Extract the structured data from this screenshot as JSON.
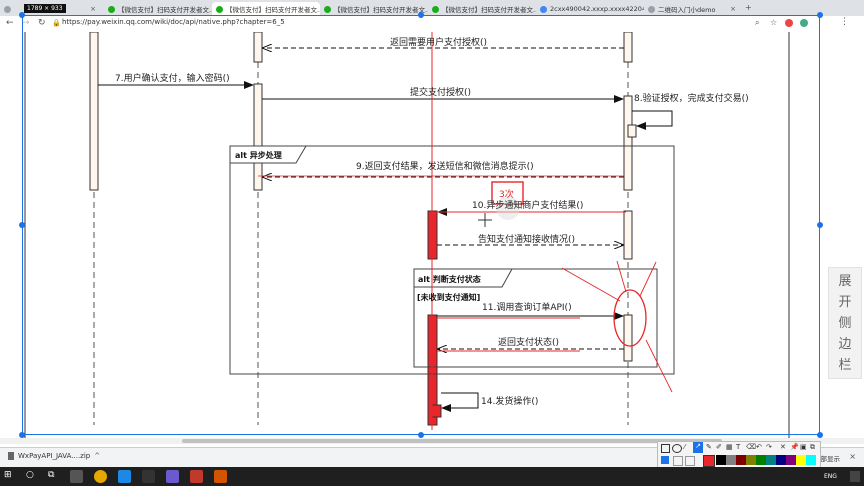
{
  "browser": {
    "tabs": [
      {
        "label": "【微信支付】扫码支付开发者文..."
      },
      {
        "label": "【微信支付】扫码支付开发者文..."
      },
      {
        "label": "【微信支付】扫码支付开发者文..."
      },
      {
        "label": "【微信支付】扫码支付开发者文..."
      },
      {
        "label": "【微信支付】扫码支付开发者文..."
      },
      {
        "label": "2cxx490042.xxxp.xxxx42204/..."
      },
      {
        "label": "二维码入门小demo"
      }
    ],
    "url": "https://pay.weixin.qq.com/wiki/doc/api/native.php?chapter=6_5"
  },
  "snip": {
    "dimensions": "1789 × 933",
    "annotation": "3次"
  },
  "diagram": {
    "msg_return_auth": "返回需要用户支付授权()",
    "msg7": "7.用户确认支付，输入密码()",
    "msg_submit_auth": "提交支付授权()",
    "msg8": "8.验证授权，完成支付交易()",
    "alt1": "alt 异步处理",
    "msg9": "9.返回支付结果，发送短信和微信消息提示()",
    "msg10": "10.异步通知商户支付结果()",
    "msg_notify_status": "告知支付通知接收情况()",
    "alt2": "alt 判断支付状态",
    "guard": "[未收到支付通知]",
    "msg11": "11.调用查询订单API()",
    "msg_return_status": "返回支付状态()",
    "msg14": "14.发货操作()"
  },
  "side_tab": [
    "展",
    "开",
    "侧",
    "边",
    "栏"
  ],
  "downloads": {
    "file": "WxPayAPI_JAVA....zip",
    "show_all": "全部显示"
  },
  "taskbar": {
    "lang": "ENG"
  },
  "colors": {
    "annotation_red": "#e8262b",
    "activation_fill": "#fff6ee"
  }
}
